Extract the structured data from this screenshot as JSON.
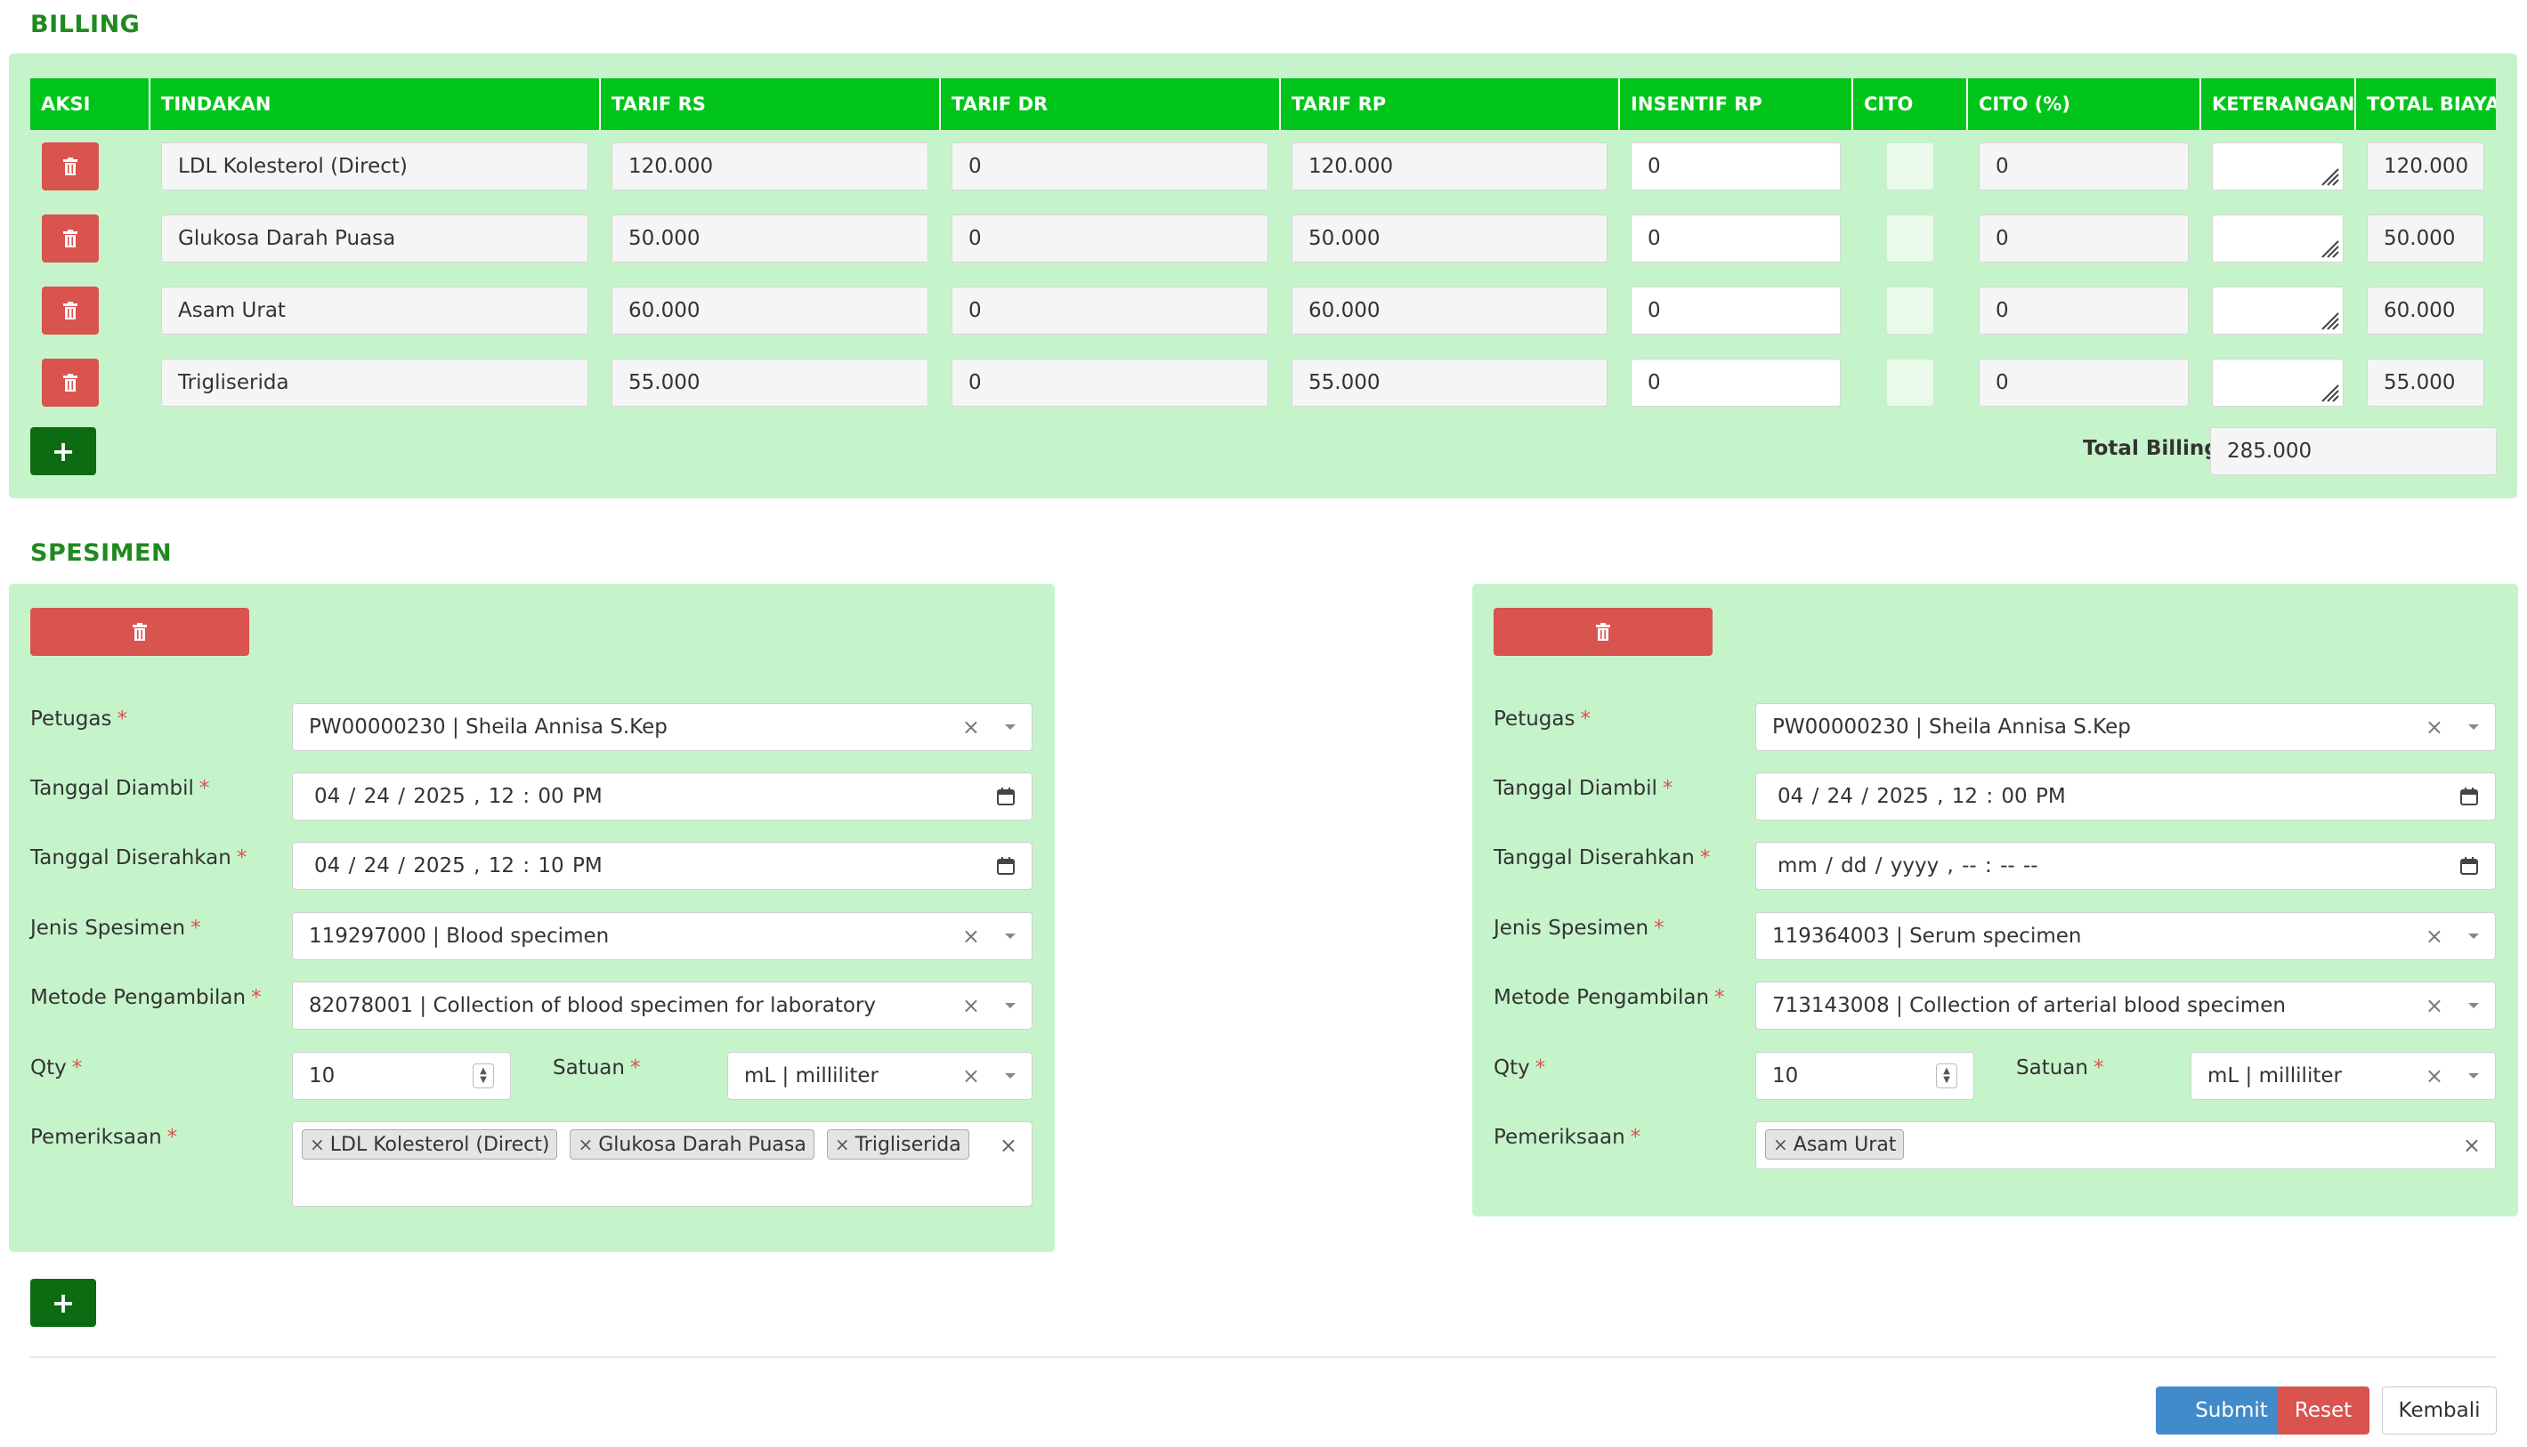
{
  "billing": {
    "title": "BILLING",
    "headers": [
      "AKSI",
      "TINDAKAN",
      "TARIF RS",
      "TARIF DR",
      "TARIF RP",
      "INSENTIF RP",
      "CITO",
      "CITO (%)",
      "KETERANGAN",
      "TOTAL BIAYA"
    ],
    "rows": [
      {
        "tindakan": "LDL Kolesterol (Direct)",
        "tarif_rs": "120.000",
        "tarif_dr": "0",
        "tarif_rp": "120.000",
        "insentif_rp": "0",
        "cito_pct": "0",
        "keterangan": "",
        "total": "120.000"
      },
      {
        "tindakan": "Glukosa Darah Puasa",
        "tarif_rs": "50.000",
        "tarif_dr": "0",
        "tarif_rp": "50.000",
        "insentif_rp": "0",
        "cito_pct": "0",
        "keterangan": "",
        "total": "50.000"
      },
      {
        "tindakan": "Asam Urat",
        "tarif_rs": "60.000",
        "tarif_dr": "0",
        "tarif_rp": "60.000",
        "insentif_rp": "0",
        "cito_pct": "0",
        "keterangan": "",
        "total": "60.000"
      },
      {
        "tindakan": "Trigliserida",
        "tarif_rs": "55.000",
        "tarif_dr": "0",
        "tarif_rp": "55.000",
        "insentif_rp": "0",
        "cito_pct": "0",
        "keterangan": "",
        "total": "55.000"
      }
    ],
    "add_label": "+",
    "total_label": "Total Billing",
    "total_value": "285.000"
  },
  "spesimen": {
    "title": "SPESIMEN",
    "labels": {
      "petugas": "Petugas",
      "tanggal_diambil": "Tanggal Diambil",
      "tanggal_diserahkan": "Tanggal Diserahkan",
      "jenis_spesimen": "Jenis Spesimen",
      "metode_pengambilan": "Metode Pengambilan",
      "qty": "Qty",
      "satuan": "Satuan",
      "pemeriksaan": "Pemeriksaan",
      "required_mark": "*"
    },
    "cards": [
      {
        "petugas": "PW00000230 | Sheila Annisa S.Kep",
        "tanggal_diambil": "04 / 24 / 2025 ,  12 : 00   PM",
        "tanggal_diserahkan": "04 / 24 / 2025 ,  12 : 10   PM",
        "jenis_spesimen": "119297000 | Blood specimen",
        "metode_pengambilan": "82078001 | Collection of blood specimen for laboratory",
        "qty": "10",
        "satuan": "mL | milliliter",
        "pemeriksaan": [
          "LDL Kolesterol (Direct)",
          "Glukosa Darah Puasa",
          "Trigliserida"
        ]
      },
      {
        "petugas": "PW00000230 | Sheila Annisa S.Kep",
        "tanggal_diambil": "04 / 24 / 2025 ,  12 : 00   PM",
        "tanggal_diserahkan": "mm / dd / yyyy ,  -- : --   --",
        "jenis_spesimen": "119364003 | Serum specimen",
        "metode_pengambilan": "713143008 | Collection of arterial blood specimen",
        "qty": "10",
        "satuan": "mL | milliliter",
        "pemeriksaan": [
          "Asam Urat"
        ]
      }
    ],
    "add_label": "+"
  },
  "footer": {
    "submit": "Submit",
    "reset": "Reset",
    "kembali": "Kembali"
  },
  "colors": {
    "panel_bg": "#c6f4ca",
    "header_green": "#00c41a",
    "title_green": "#1f8a1f",
    "danger": "#d9534f",
    "add_green": "#0d6b12",
    "primary": "#428bca"
  }
}
